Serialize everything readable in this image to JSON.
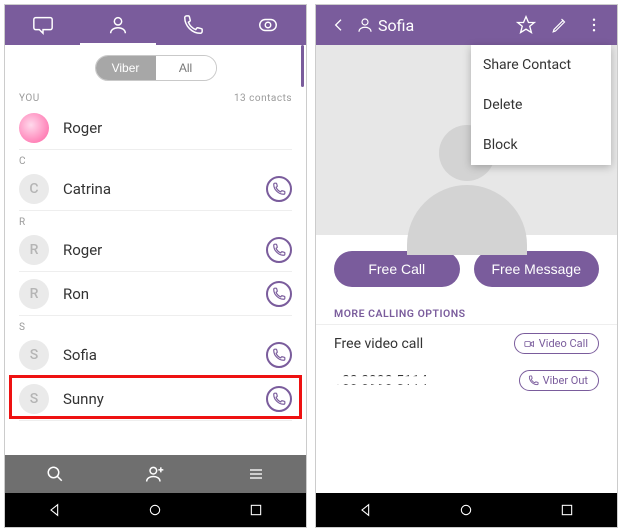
{
  "left": {
    "tabs": {
      "viber": "Viber",
      "all": "All"
    },
    "you_label": "YOU",
    "contacts_count": "13 contacts",
    "me_name": "Roger",
    "sections": {
      "c": "C",
      "r": "R",
      "s": "S"
    },
    "contacts": {
      "catrina": {
        "initial": "C",
        "name": "Catrina"
      },
      "roger": {
        "initial": "R",
        "name": "Roger"
      },
      "ron": {
        "initial": "R",
        "name": "Ron"
      },
      "sofia": {
        "initial": "S",
        "name": "Sofia"
      },
      "sunny": {
        "initial": "S",
        "name": "Sunny"
      }
    }
  },
  "right": {
    "title": "Sofia",
    "menu": {
      "share": "Share Contact",
      "delete": "Delete",
      "block": "Block"
    },
    "actions": {
      "call": "Free Call",
      "message": "Free Message"
    },
    "more_label": "MORE CALLING OPTIONS",
    "options": {
      "video_label": "Free video call",
      "video_chip": "Video Call",
      "phone_masked": "+00 0990 5114",
      "viber_out_chip": "Viber Out"
    }
  }
}
